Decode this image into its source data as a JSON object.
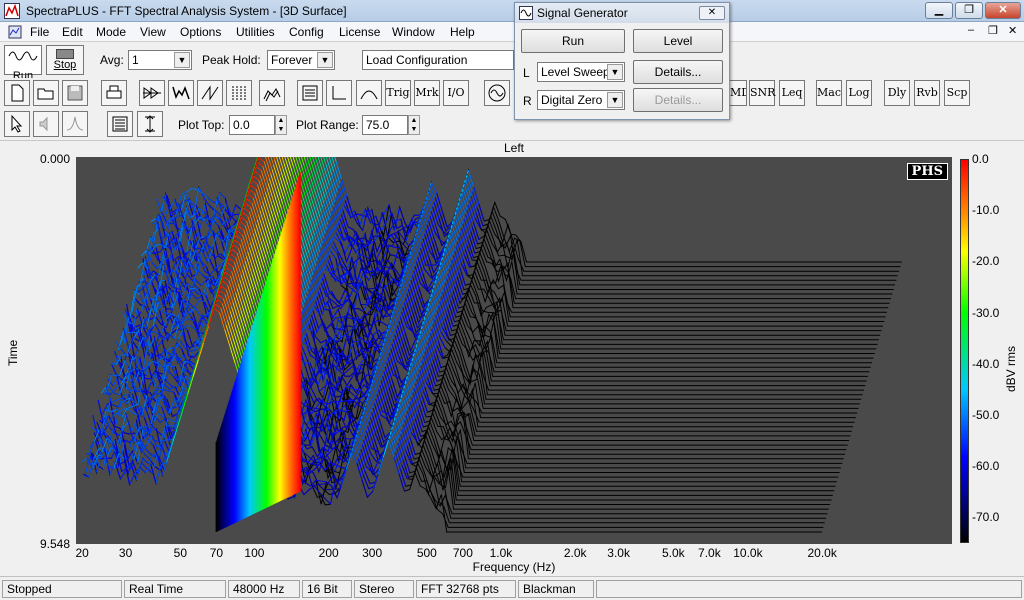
{
  "window": {
    "title": "SpectraPLUS - FFT Spectral Analysis System - [3D Surface]"
  },
  "menu": [
    "File",
    "Edit",
    "Mode",
    "View",
    "Options",
    "Utilities",
    "Config",
    "License",
    "Window",
    "Help"
  ],
  "toolbar1": {
    "run_label": "Run",
    "stop_label": "Stop",
    "avg_label": "Avg:",
    "avg_value": "1",
    "peak_hold_label": "Peak Hold:",
    "peak_hold_value": "Forever",
    "load_config_value": "Load Configuration"
  },
  "toolbar2_text_buttons": [
    "Trig",
    "Mrk",
    "I/O",
    "MD",
    "SNR",
    "Leq",
    "Mac",
    "Log",
    "Dly",
    "Rvb",
    "Scp"
  ],
  "toolbar3": {
    "plot_top_label": "Plot Top:",
    "plot_top_value": "0.0",
    "plot_range_label": "Plot Range:",
    "plot_range_value": "75.0"
  },
  "signal_generator": {
    "title": "Signal Generator",
    "run_label": "Run",
    "level_label": "Level",
    "left_label": "L",
    "left_value": "Level Sweep",
    "details_label": "Details...",
    "right_label": "R",
    "right_value": "Digital Zero",
    "details2_label": "Details..."
  },
  "chart_data": {
    "type": "heatmap",
    "subtype": "3d-waterfall-surface",
    "title": "Left",
    "logo": "PHS",
    "xlabel": "Frequency (Hz)",
    "ylabel": "Time",
    "x_scale": "log",
    "x_ticks": [
      "20",
      "30",
      "50",
      "70",
      "100",
      "200",
      "300",
      "500",
      "700",
      "1.0k",
      "2.0k",
      "3.0k",
      "5.0k",
      "7.0k",
      "10.0k",
      "20.0k"
    ],
    "x_tick_values": [
      20,
      30,
      50,
      70,
      100,
      200,
      300,
      500,
      700,
      1000,
      2000,
      3000,
      5000,
      7000,
      10000,
      20000
    ],
    "y_top": "0.000",
    "y_bottom": "9.548",
    "colorbar_label": "dBV rms",
    "colorbar_ticks": [
      "0.0",
      "-10.0",
      "-20.0",
      "-30.0",
      "-40.0",
      "-50.0",
      "-60.0",
      "-70.0"
    ],
    "colorbar_range": [
      0,
      -75
    ],
    "peaks": [
      {
        "freq": 70,
        "level": 0.0
      },
      {
        "freq": 50,
        "level": -45
      },
      {
        "freq": 35,
        "level": -52
      },
      {
        "freq": 250,
        "level": -48
      },
      {
        "freq": 350,
        "level": -45
      },
      {
        "freq": 450,
        "level": -55
      }
    ]
  },
  "status": [
    "Stopped",
    "Real Time",
    "48000 Hz",
    "16 Bit",
    "Stereo",
    "FFT 32768 pts",
    "Blackman"
  ]
}
